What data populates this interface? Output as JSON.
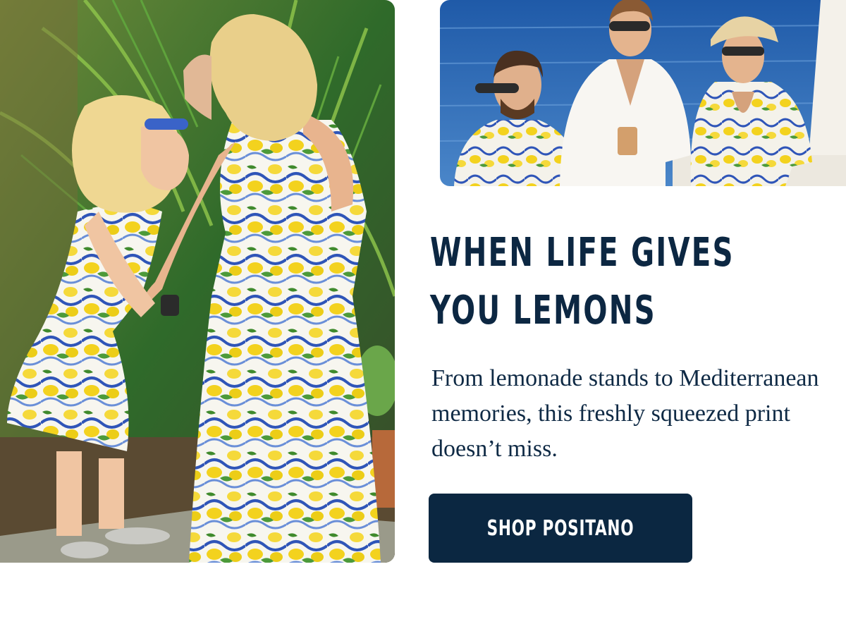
{
  "hero": {
    "headline_line1": "WHEN LIFE GIVES",
    "headline_line2": "YOU LEMONS",
    "body": "From lemonade stands to Mediterranean memories, this freshly squeezed print doesn’t miss.",
    "cta_label": "SHOP POSITANO"
  },
  "colors": {
    "navy": "#0b2741",
    "lemon_yellow": "#f3d21e",
    "print_blue": "#2f55b8",
    "sea_blue": "#2f69b5",
    "foliage_green": "#3f8a2c"
  }
}
